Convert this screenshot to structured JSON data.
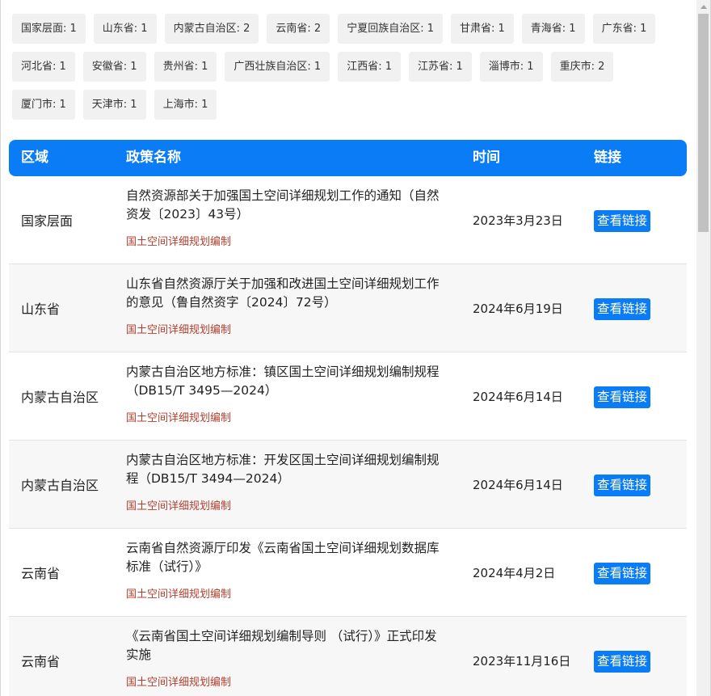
{
  "region_tags": [
    "国家层面: 1",
    "山东省: 1",
    "内蒙古自治区: 2",
    "云南省: 2",
    "宁夏回族自治区: 1",
    "甘肃省: 1",
    "青海省: 1",
    "广东省: 1",
    "河北省: 1",
    "安徽省: 1",
    "贵州省: 1",
    "广西壮族自治区: 1",
    "江西省: 1",
    "江苏省: 1",
    "淄博市: 1",
    "重庆市: 2",
    "厦门市: 1",
    "天津市: 1",
    "上海市: 1"
  ],
  "table": {
    "headers": {
      "region": "区域",
      "name": "政策名称",
      "date": "时间",
      "link": "链接"
    },
    "rows": [
      {
        "region": "国家层面",
        "name": "自然资源部关于加强国土空间详细规划工作的通知（自然资发〔2023〕43号）",
        "tag": "国土空间详细规划编制",
        "date": "2023年3月23日",
        "link": "查看链接"
      },
      {
        "region": "山东省",
        "name": "山东省自然资源厅关于加强和改进国土空间详细规划工作的意见（鲁自然资字〔2024〕72号）",
        "tag": "国土空间详细规划编制",
        "date": "2024年6月19日",
        "link": "查看链接"
      },
      {
        "region": "内蒙古自治区",
        "name": "内蒙古自治区地方标准：镇区国土空间详细规划编制规程（DB15/T 3495—2024）",
        "tag": "国土空间详细规划编制",
        "date": "2024年6月14日",
        "link": "查看链接"
      },
      {
        "region": "内蒙古自治区",
        "name": "内蒙古自治区地方标准：开发区国土空间详细规划编制规程（DB15/T 3494—2024）",
        "tag": "国土空间详细规划编制",
        "date": "2024年6月14日",
        "link": "查看链接"
      },
      {
        "region": "云南省",
        "name": "云南省自然资源厅印发《云南省国土空间详细规划数据库标准（试行）》",
        "tag": "国土空间详细规划编制",
        "date": "2024年4月2日",
        "link": "查看链接"
      },
      {
        "region": "云南省",
        "name": "《云南省国土空间详细规划编制导则 （试行）》正式印发实施",
        "tag": "国土空间详细规划编制",
        "date": "2023年11月16日",
        "link": "查看链接"
      }
    ]
  }
}
